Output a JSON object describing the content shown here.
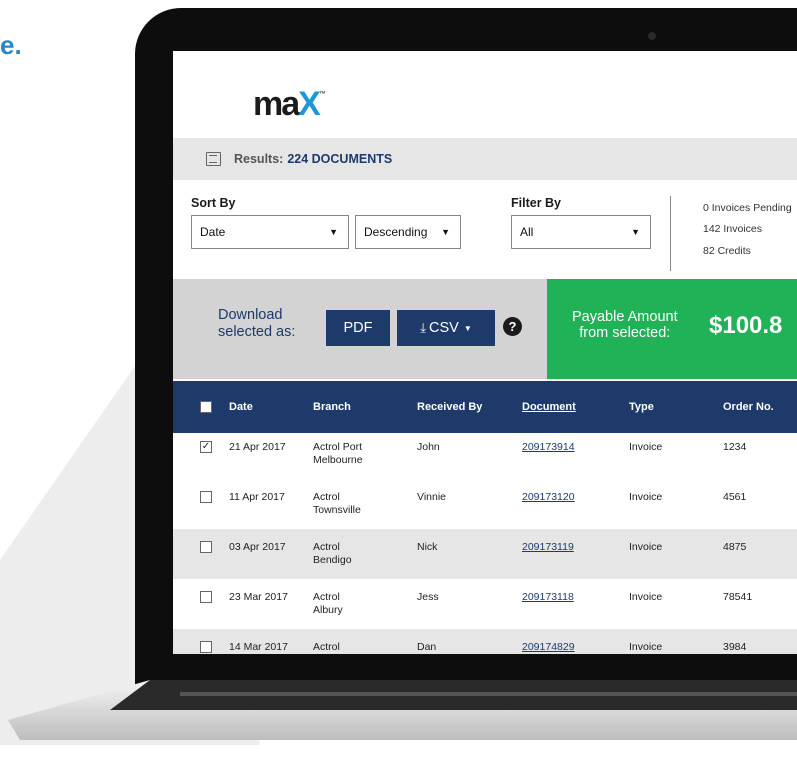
{
  "headline": "e.",
  "logo": {
    "text_main": "ma",
    "text_x": "X",
    "tm": "™"
  },
  "results": {
    "label": "Results:",
    "count": "224 DOCUMENTS"
  },
  "sort": {
    "label": "Sort By",
    "field": "Date",
    "order": "Descending"
  },
  "filter": {
    "label": "Filter By",
    "value": "All"
  },
  "summary": {
    "pending": "0 Invoices Pending",
    "invoices": "142 Invoices",
    "credits": "82 Credits"
  },
  "download": {
    "label_line1": "Download",
    "label_line2": "selected as:",
    "pdf": "PDF",
    "csv": "CSV",
    "help": "?"
  },
  "payable": {
    "line1": "Payable Amount",
    "line2": "from selected:",
    "amount": "$100.8"
  },
  "table": {
    "headers": {
      "date": "Date",
      "branch": "Branch",
      "received_by": "Received By",
      "document": "Document",
      "type": "Type",
      "order_no": "Order No."
    },
    "rows": [
      {
        "checked": "✓",
        "date": "21 Apr 2017",
        "branch1": "Actrol Port",
        "branch2": "Melbourne",
        "received_by": "John",
        "document": "209173914",
        "type": "Invoice",
        "order_no": "1234"
      },
      {
        "checked": "",
        "date": "11 Apr 2017",
        "branch1": "Actrol",
        "branch2": "Townsville",
        "received_by": "Vinnie",
        "document": "209173120",
        "type": "Invoice",
        "order_no": "4561"
      },
      {
        "checked": "",
        "date": "03 Apr 2017",
        "branch1": "Actrol",
        "branch2": "Bendigo",
        "received_by": "Nick",
        "document": "209173119",
        "type": "Invoice",
        "order_no": "4875"
      },
      {
        "checked": "",
        "date": "23 Mar 2017",
        "branch1": "Actrol",
        "branch2": "Albury",
        "received_by": "Jess",
        "document": "209173118",
        "type": "Invoice",
        "order_no": "78541"
      },
      {
        "checked": "",
        "date": "14 Mar 2017",
        "branch1": "Actrol",
        "branch2": "",
        "received_by": "Dan",
        "document": "209174829",
        "type": "Invoice",
        "order_no": "3984"
      }
    ]
  },
  "colors": {
    "navy": "#1d3a6b",
    "green": "#21b157",
    "accent_blue": "#2a86c6",
    "gray_bar": "#e6e6e6"
  }
}
